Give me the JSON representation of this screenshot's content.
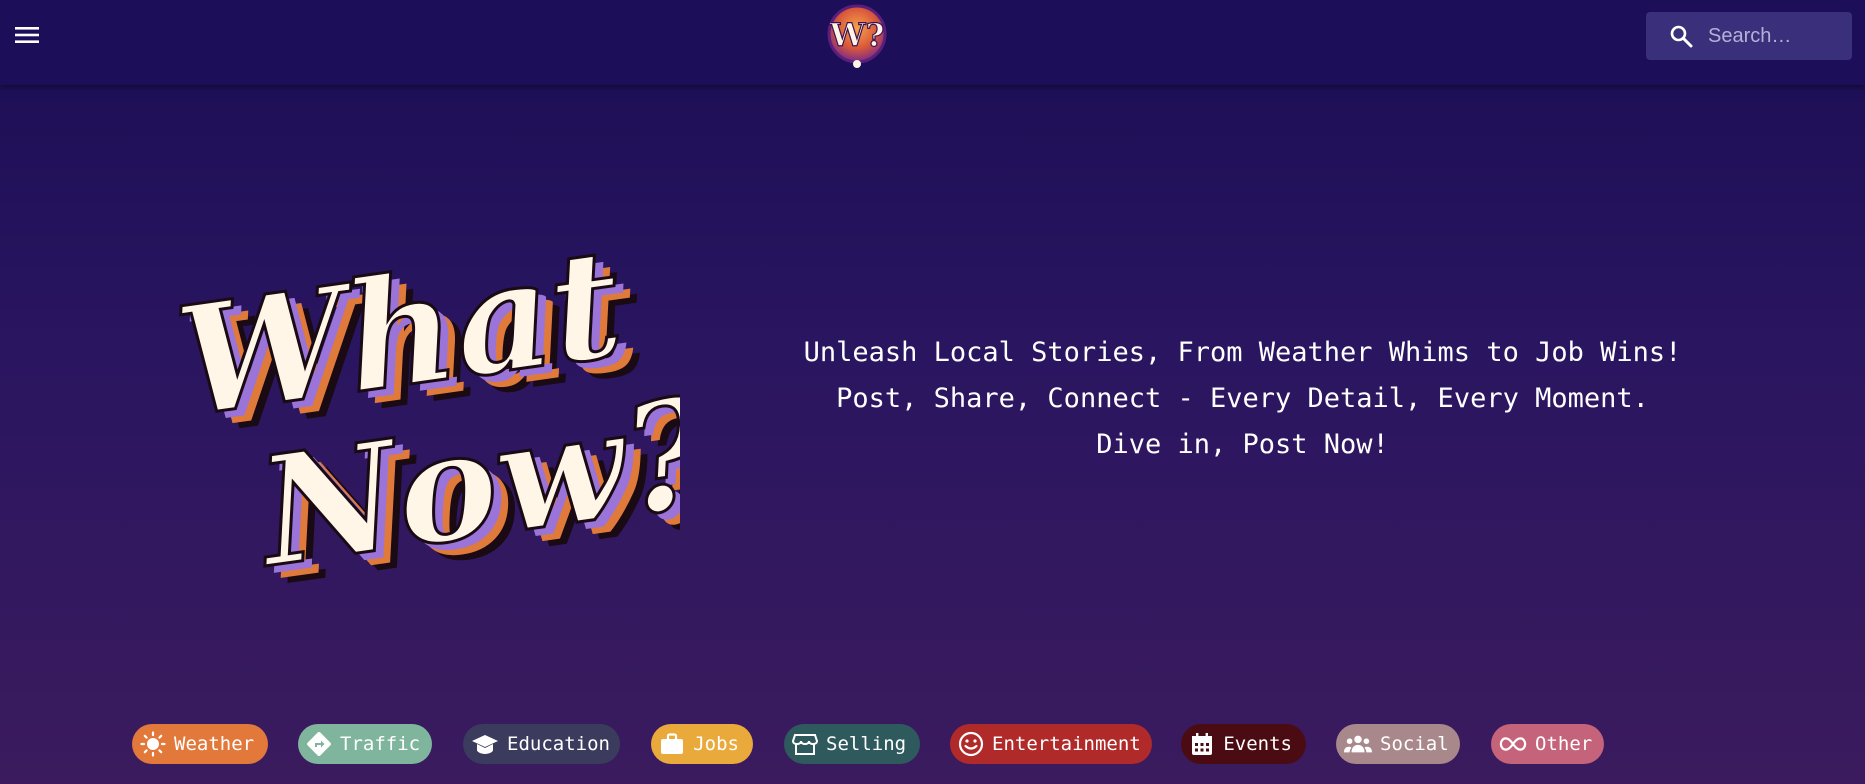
{
  "header": {
    "search_placeholder": "Search…"
  },
  "logo": {
    "text": "W?"
  },
  "hero": {
    "title_line1": "What",
    "title_line2": "Now?",
    "tagline": [
      "Unleash Local Stories, From Weather Whims to Job Wins!",
      "Post, Share, Connect - Every Detail, Every Moment.",
      "Dive in, Post Now!"
    ]
  },
  "categories": [
    {
      "label": "Weather",
      "icon": "sun-icon",
      "color": "#e2793a"
    },
    {
      "label": "Traffic",
      "icon": "directions-icon",
      "color": "#7fb59c"
    },
    {
      "label": "Education",
      "icon": "graduation-cap-icon",
      "color": "#3b3b5e"
    },
    {
      "label": "Jobs",
      "icon": "briefcase-icon",
      "color": "#e9a93b"
    },
    {
      "label": "Selling",
      "icon": "storefront-icon",
      "color": "#2e5a5e"
    },
    {
      "label": "Entertainment",
      "icon": "smiley-icon",
      "color": "#b02a2a"
    },
    {
      "label": "Events",
      "icon": "calendar-icon",
      "color": "#4a0c12"
    },
    {
      "label": "Social",
      "icon": "people-icon",
      "color": "#a8888a"
    },
    {
      "label": "Other",
      "icon": "infinity-icon",
      "color": "#c4637a"
    }
  ]
}
